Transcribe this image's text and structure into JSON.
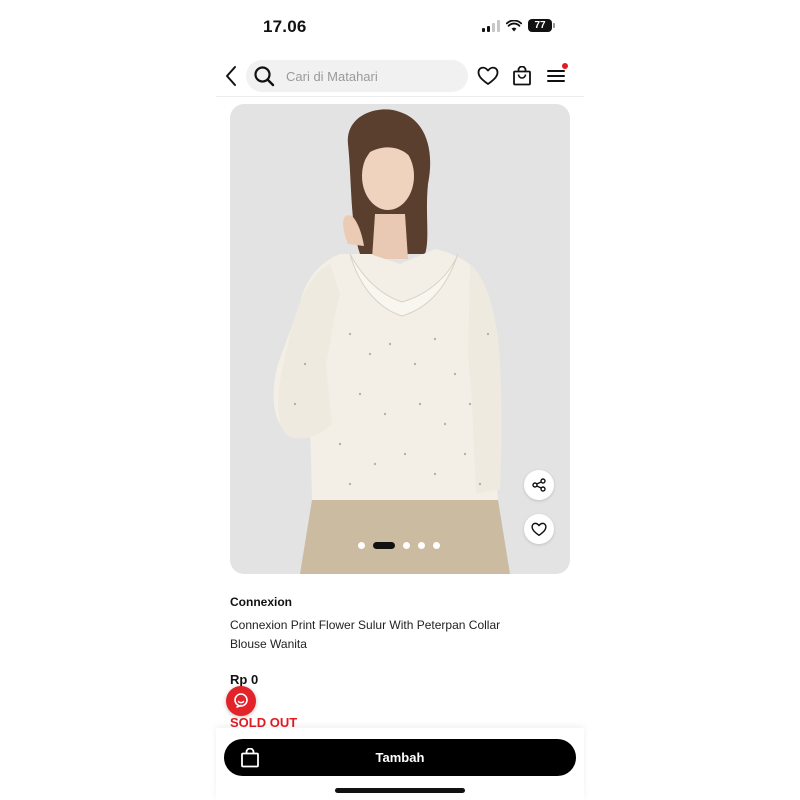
{
  "status_bar": {
    "time": "17.06",
    "battery": "77"
  },
  "header": {
    "search_placeholder": "Cari di Matahari"
  },
  "product": {
    "brand": "Connexion",
    "title": "Connexion Print Flower Sulur With Peterpan Collar Blouse Wanita",
    "price": "Rp 0",
    "status": "SOLD OUT",
    "image_count": 5,
    "active_image": 2
  },
  "bottom_bar": {
    "add_label": "Tambah"
  },
  "icons": [
    "back-icon",
    "search-icon",
    "heart-icon",
    "bag-icon",
    "menu-icon",
    "share-icon",
    "chat-icon"
  ],
  "colors": {
    "accent": "#e11b22",
    "button": "#000000",
    "image_bg": "#e3e3e3"
  }
}
